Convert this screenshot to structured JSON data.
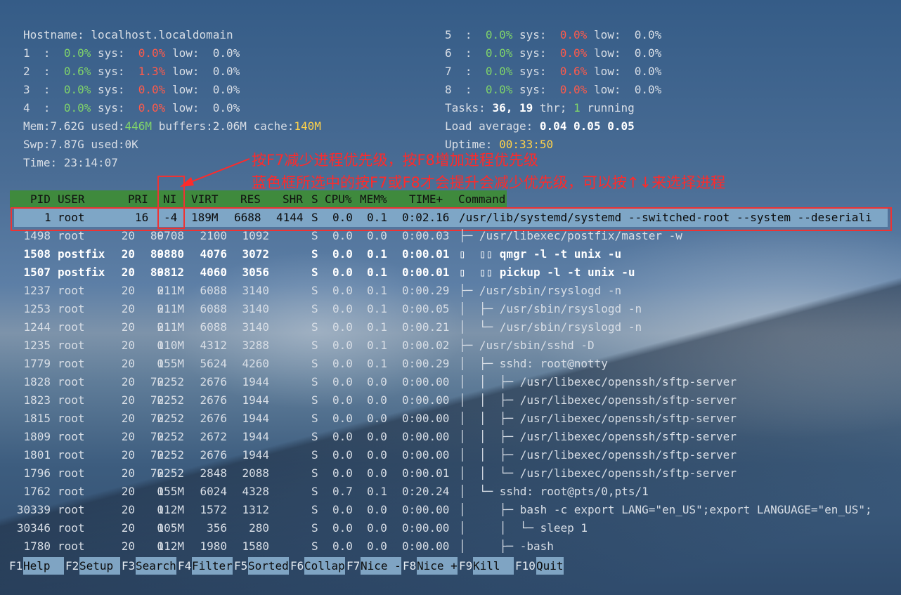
{
  "summary": {
    "hostname_label": "Hostname:",
    "hostname": "localhost.localdomain",
    "cpus": [
      {
        "id": "1",
        "usr": "0.0%",
        "sys": "0.0%",
        "low": "0.0%"
      },
      {
        "id": "2",
        "usr": "0.6%",
        "sys": "1.3%",
        "low": "0.0%"
      },
      {
        "id": "3",
        "usr": "0.0%",
        "sys": "0.0%",
        "low": "0.0%"
      },
      {
        "id": "4",
        "usr": "0.0%",
        "sys": "0.0%",
        "low": "0.0%"
      },
      {
        "id": "5",
        "usr": "0.0%",
        "sys": "0.0%",
        "low": "0.0%"
      },
      {
        "id": "6",
        "usr": "0.0%",
        "sys": "0.0%",
        "low": "0.0%"
      },
      {
        "id": "7",
        "usr": "0.0%",
        "sys": "0.6%",
        "low": "0.0%"
      },
      {
        "id": "8",
        "usr": "0.0%",
        "sys": "0.0%",
        "low": "0.0%"
      }
    ],
    "mem_total": "Mem:7.62G",
    "mem_used_label": "used:",
    "mem_used": "446M",
    "mem_buffers": "buffers:2.06M",
    "mem_cache_label": "cache:",
    "mem_cache": "140M",
    "swp": "Swp:7.87G used:0K",
    "time": "Time: 23:14:07",
    "tasks_label": "Tasks:",
    "tasks_count": "36,",
    "thr_count": "19",
    "thr_label": "thr;",
    "running_count": "1",
    "running_label": "running",
    "load_label": "Load average:",
    "load_values": "0.04 0.05 0.05",
    "uptime_label": "Uptime:",
    "uptime": "00:33:50"
  },
  "annotation": {
    "line1": "按F7减少进程优先级，按F8增加进程优先级",
    "line2": "蓝色框所选中的按F7或F8才会提升会减少优先级，可以按↑↓来选择进程"
  },
  "columns": [
    "PID",
    "USER",
    "PRI",
    "NI",
    "VIRT",
    "RES",
    "SHR",
    "S",
    "CPU%",
    "MEM%",
    "TIME+",
    "Command"
  ],
  "selected": {
    "pid": "1",
    "user": "root",
    "pri": "16",
    "ni": "-4",
    "virt": "189M",
    "res": "6688",
    "shr": "4144",
    "s": "S",
    "cpu": "0.0",
    "mem": "0.1",
    "time": "0:02.16",
    "cmd": "/usr/lib/systemd/systemd --switched-root --system --deseriali"
  },
  "processes": [
    {
      "pid": "1498",
      "user": "root",
      "pri": "20",
      "ni": "0",
      "virt": "89708",
      "res": "2100",
      "shr": "1092",
      "s": "S",
      "cpu": "0.0",
      "mem": "0.0",
      "time": "0:00.03",
      "cmd": "├─ /usr/libexec/postfix/master -w",
      "bold": false
    },
    {
      "pid": "1508",
      "user": "postfix",
      "pri": "20",
      "ni": "0",
      "virt": "89880",
      "res": "4076",
      "shr": "3072",
      "s": "S",
      "cpu": "0.0",
      "mem": "0.1",
      "time": "0:00.01",
      "cmd": "▯  ▯▯ qmgr -l -t unix -u",
      "bold": true
    },
    {
      "pid": "1507",
      "user": "postfix",
      "pri": "20",
      "ni": "0",
      "virt": "89812",
      "res": "4060",
      "shr": "3056",
      "s": "S",
      "cpu": "0.0",
      "mem": "0.1",
      "time": "0:00.01",
      "cmd": "▯  ▯▯ pickup -l -t unix -u",
      "bold": true
    },
    {
      "pid": "1237",
      "user": "root",
      "pri": "20",
      "ni": "0",
      "virt": "211M",
      "res": "6088",
      "shr": "3140",
      "s": "S",
      "cpu": "0.0",
      "mem": "0.1",
      "time": "0:00.29",
      "cmd": "├─ /usr/sbin/rsyslogd -n",
      "bold": false
    },
    {
      "pid": "1253",
      "user": "root",
      "pri": "20",
      "ni": "0",
      "virt": "211M",
      "res": "6088",
      "shr": "3140",
      "s": "S",
      "cpu": "0.0",
      "mem": "0.1",
      "time": "0:00.05",
      "cmd": "│  ├─ /usr/sbin/rsyslogd -n",
      "bold": false
    },
    {
      "pid": "1244",
      "user": "root",
      "pri": "20",
      "ni": "0",
      "virt": "211M",
      "res": "6088",
      "shr": "3140",
      "s": "S",
      "cpu": "0.0",
      "mem": "0.1",
      "time": "0:00.21",
      "cmd": "│  └─ /usr/sbin/rsyslogd -n",
      "bold": false
    },
    {
      "pid": "1235",
      "user": "root",
      "pri": "20",
      "ni": "0",
      "virt": "110M",
      "res": "4312",
      "shr": "3288",
      "s": "S",
      "cpu": "0.0",
      "mem": "0.1",
      "time": "0:00.02",
      "cmd": "├─ /usr/sbin/sshd -D",
      "bold": false
    },
    {
      "pid": "1779",
      "user": "root",
      "pri": "20",
      "ni": "0",
      "virt": "155M",
      "res": "5624",
      "shr": "4260",
      "s": "S",
      "cpu": "0.0",
      "mem": "0.1",
      "time": "0:00.29",
      "cmd": "│  ├─ sshd: root@notty",
      "bold": false
    },
    {
      "pid": "1828",
      "user": "root",
      "pri": "20",
      "ni": "0",
      "virt": "72252",
      "res": "2676",
      "shr": "1944",
      "s": "S",
      "cpu": "0.0",
      "mem": "0.0",
      "time": "0:00.00",
      "cmd": "│  │  ├─ /usr/libexec/openssh/sftp-server",
      "bold": false
    },
    {
      "pid": "1823",
      "user": "root",
      "pri": "20",
      "ni": "0",
      "virt": "72252",
      "res": "2676",
      "shr": "1944",
      "s": "S",
      "cpu": "0.0",
      "mem": "0.0",
      "time": "0:00.00",
      "cmd": "│  │  ├─ /usr/libexec/openssh/sftp-server",
      "bold": false
    },
    {
      "pid": "1815",
      "user": "root",
      "pri": "20",
      "ni": "0",
      "virt": "72252",
      "res": "2676",
      "shr": "1944",
      "s": "S",
      "cpu": "0.0",
      "mem": "0.0",
      "time": "0:00.00",
      "cmd": "│  │  ├─ /usr/libexec/openssh/sftp-server",
      "bold": false
    },
    {
      "pid": "1809",
      "user": "root",
      "pri": "20",
      "ni": "0",
      "virt": "72252",
      "res": "2672",
      "shr": "1944",
      "s": "S",
      "cpu": "0.0",
      "mem": "0.0",
      "time": "0:00.00",
      "cmd": "│  │  ├─ /usr/libexec/openssh/sftp-server",
      "bold": false
    },
    {
      "pid": "1801",
      "user": "root",
      "pri": "20",
      "ni": "0",
      "virt": "72252",
      "res": "2676",
      "shr": "1944",
      "s": "S",
      "cpu": "0.0",
      "mem": "0.0",
      "time": "0:00.00",
      "cmd": "│  │  ├─ /usr/libexec/openssh/sftp-server",
      "bold": false
    },
    {
      "pid": "1796",
      "user": "root",
      "pri": "20",
      "ni": "0",
      "virt": "72252",
      "res": "2848",
      "shr": "2088",
      "s": "S",
      "cpu": "0.0",
      "mem": "0.0",
      "time": "0:00.01",
      "cmd": "│  │  └─ /usr/libexec/openssh/sftp-server",
      "bold": false
    },
    {
      "pid": "1762",
      "user": "root",
      "pri": "20",
      "ni": "0",
      "virt": "155M",
      "res": "6024",
      "shr": "4328",
      "s": "S",
      "cpu": "0.7",
      "mem": "0.1",
      "time": "0:20.24",
      "cmd": "│  └─ sshd: root@pts/0,pts/1",
      "bold": false
    },
    {
      "pid": "30339",
      "user": "root",
      "pri": "20",
      "ni": "0",
      "virt": "112M",
      "res": "1572",
      "shr": "1312",
      "s": "S",
      "cpu": "0.0",
      "mem": "0.0",
      "time": "0:00.00",
      "cmd": "│     ├─ bash -c export LANG=\"en_US\";export LANGUAGE=\"en_US\";",
      "bold": false
    },
    {
      "pid": "30346",
      "user": "root",
      "pri": "20",
      "ni": "0",
      "virt": "105M",
      "res": "356",
      "shr": "280",
      "s": "S",
      "cpu": "0.0",
      "mem": "0.0",
      "time": "0:00.00",
      "cmd": "│     │  └─ sleep 1",
      "bold": false
    },
    {
      "pid": "1780",
      "user": "root",
      "pri": "20",
      "ni": "0",
      "virt": "112M",
      "res": "1980",
      "shr": "1580",
      "s": "S",
      "cpu": "0.0",
      "mem": "0.0",
      "time": "0:00.00",
      "cmd": "│     ├─ -bash",
      "bold": false
    }
  ],
  "function_keys": [
    {
      "key": "F1",
      "label": "Help  "
    },
    {
      "key": "F2",
      "label": "Setup "
    },
    {
      "key": "F3",
      "label": "Search"
    },
    {
      "key": "F4",
      "label": "Filter"
    },
    {
      "key": "F5",
      "label": "Sorted"
    },
    {
      "key": "F6",
      "label": "Collap"
    },
    {
      "key": "F7",
      "label": "Nice -"
    },
    {
      "key": "F8",
      "label": "Nice +"
    },
    {
      "key": "F9",
      "label": "Kill  "
    },
    {
      "key": "F10",
      "label": "Quit"
    }
  ],
  "colors": {
    "header_bg": "#3f8a3d",
    "selected_bg": "#7ea6c6",
    "annotation": "#ff2a2a",
    "usr": "#7fd36a",
    "sys": "#ff5a4a",
    "highlight": "#ffd24a"
  }
}
